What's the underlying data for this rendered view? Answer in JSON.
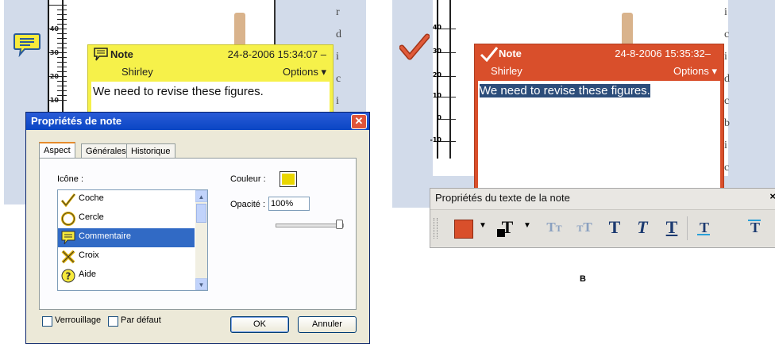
{
  "left": {
    "ruler_labels": [
      "40",
      "30",
      "20",
      "10"
    ],
    "note": {
      "title": "Note",
      "timestamp": "24-8-2006 15:34:07",
      "author": "Shirley",
      "options": "Options",
      "body": "We need to revise these figures."
    },
    "dialog": {
      "title": "Propriétés de note",
      "tabs": [
        "Aspect",
        "Générales",
        "Historique de révisions"
      ],
      "icon_label": "Icône :",
      "icons": [
        "Coche",
        "Cercle",
        "Commentaire",
        "Croix",
        "Aide"
      ],
      "selected_icon": "Commentaire",
      "color_label": "Couleur :",
      "color_value": "#e9d600",
      "opacity_label": "Opacité :",
      "opacity_value": "100%",
      "lock_label": "Verrouillage",
      "default_label": "Par défaut",
      "ok": "OK",
      "cancel": "Annuler"
    }
  },
  "right": {
    "ruler_labels": [
      "40",
      "30",
      "20",
      "10",
      "0",
      "-10"
    ],
    "note": {
      "title": "Note",
      "timestamp": "24-8-2006 15:35:32",
      "author": "Shirley",
      "options": "Options",
      "body": "We need to revise these figures."
    },
    "toolbar": {
      "title": "Propriétés du texte de la note",
      "close": "×",
      "fill_color": "#d94f2b",
      "text_color": "#000000"
    },
    "caption": "B"
  }
}
